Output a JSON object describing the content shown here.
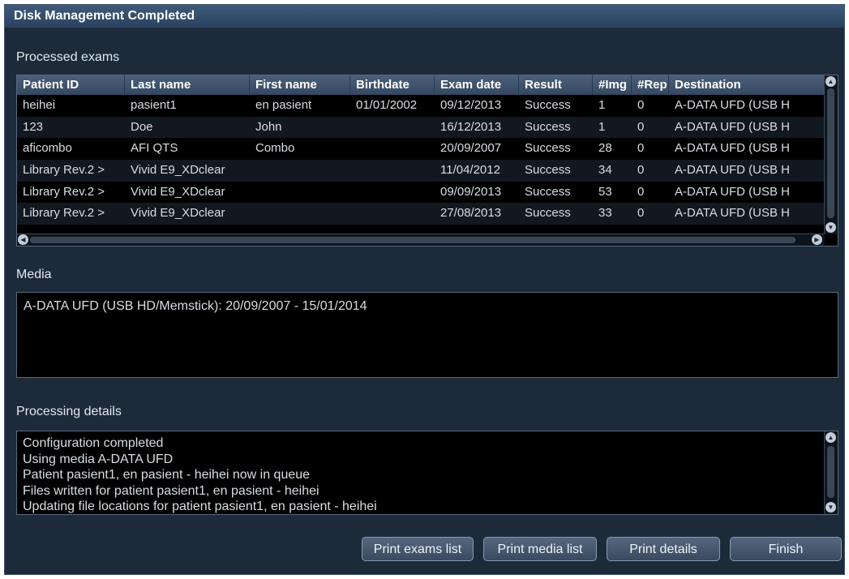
{
  "window": {
    "title": "Disk Management Completed"
  },
  "exams": {
    "label": "Processed exams",
    "columns": [
      "Patient ID",
      "Last name",
      "First name",
      "Birthdate",
      "Exam date",
      "Result",
      "#Img",
      "#Rep",
      "Destination"
    ],
    "rows": [
      [
        "heihei",
        "pasient1",
        "en pasient",
        "01/01/2002",
        "09/12/2013",
        "Success",
        "1",
        "0",
        "A-DATA UFD (USB H"
      ],
      [
        "123",
        "Doe",
        "John",
        "",
        "16/12/2013",
        "Success",
        "1",
        "0",
        "A-DATA UFD (USB H"
      ],
      [
        "aficombo",
        "AFI QTS",
        "Combo",
        "",
        "20/09/2007",
        "Success",
        "28",
        "0",
        "A-DATA UFD (USB H"
      ],
      [
        "Library Rev.2 >",
        "Vivid E9_XDclear",
        "",
        "",
        "11/04/2012",
        "Success",
        "34",
        "0",
        "A-DATA UFD (USB H"
      ],
      [
        "Library Rev.2 >",
        "Vivid E9_XDclear",
        "",
        "",
        "09/09/2013",
        "Success",
        "53",
        "0",
        "A-DATA UFD (USB H"
      ],
      [
        "Library Rev.2 >",
        "Vivid E9_XDclear",
        "",
        "",
        "27/08/2013",
        "Success",
        "33",
        "0",
        "A-DATA UFD (USB H"
      ]
    ]
  },
  "media": {
    "label": "Media",
    "text": "A-DATA UFD (USB HD/Memstick): 20/09/2007 - 15/01/2014"
  },
  "details": {
    "label": "Processing details",
    "lines": [
      "Configuration completed",
      "Using media A-DATA UFD",
      "Patient pasient1, en pasient - heihei now in queue",
      "Files written for patient pasient1, en pasient - heihei",
      "Updating file locations for patient pasient1, en pasient - heihei"
    ]
  },
  "buttons": {
    "print_exams": "Print exams list",
    "print_media": "Print media list",
    "print_details": "Print details",
    "finish": "Finish"
  },
  "icons": {
    "scroll_up": "scroll-up-icon",
    "scroll_down": "scroll-down-icon",
    "scroll_left": "scroll-left-icon",
    "scroll_right": "scroll-right-icon"
  },
  "colors": {
    "dialog_bg": "#1c2a3a",
    "title_bar": "#3f5a7a",
    "panel_bg": "#000000",
    "header_bg": "#4c5f78"
  }
}
